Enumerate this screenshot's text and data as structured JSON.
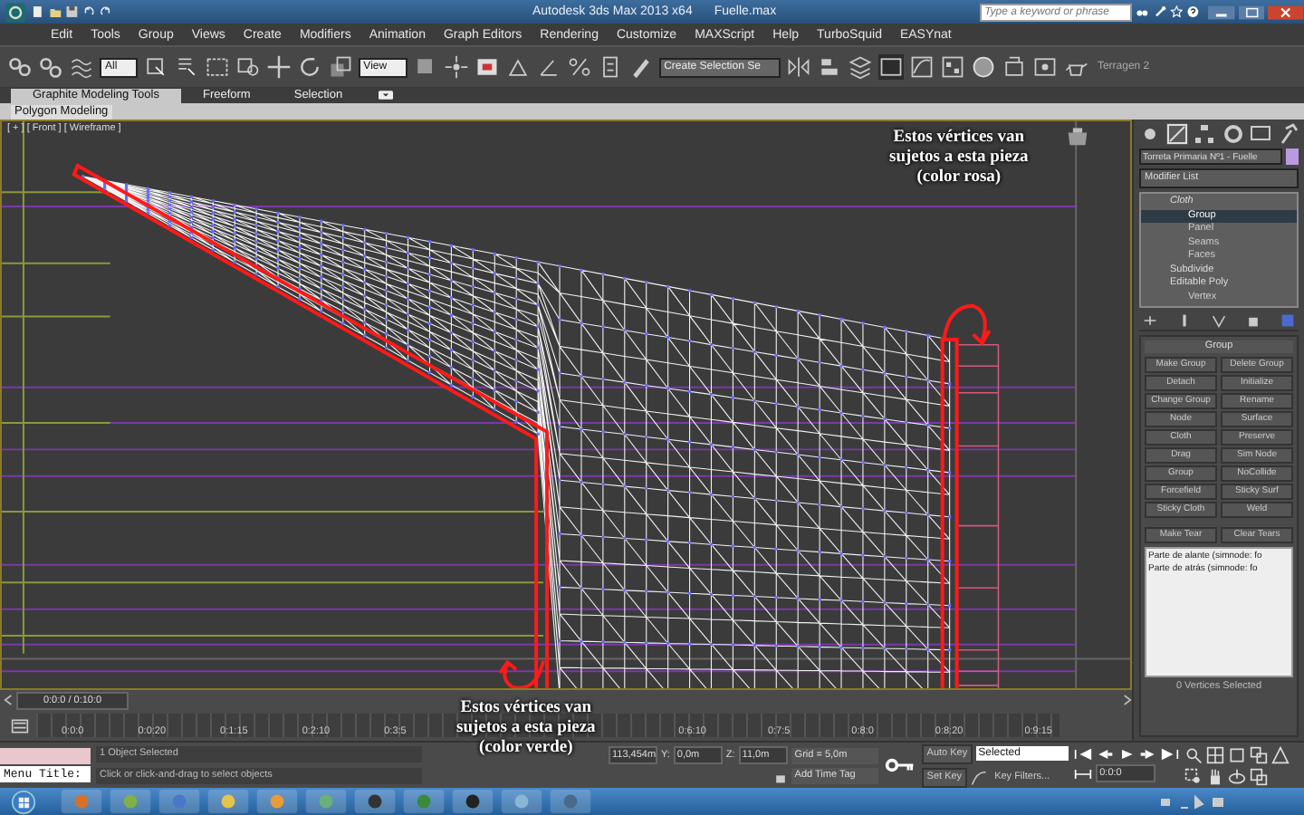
{
  "window": {
    "title": "Autodesk 3ds Max 2013 x64",
    "file": "Fuelle.max",
    "search": {
      "placeholder": "Type a keyword or phrase"
    }
  },
  "menu": [
    "Edit",
    "Tools",
    "Group",
    "Views",
    "Create",
    "Modifiers",
    "Animation",
    "Graph Editors",
    "Rendering",
    "Customize",
    "MAXScript",
    "Help",
    "TurboSquid",
    "EASYnat"
  ],
  "toolbar": {
    "selection_filter": "All",
    "reference_coord": "View",
    "named_selection": "Create Selection Se",
    "plugin_label": "Terragen 2"
  },
  "ribbon": {
    "tabs": [
      {
        "label": "Graphite Modeling Tools",
        "selected": true
      },
      {
        "label": "Freeform",
        "selected": false
      },
      {
        "label": "Selection",
        "selected": false
      }
    ],
    "panel": "Polygon Modeling"
  },
  "viewport": {
    "label": "[ + ] [ Front ] [ Wireframe ]",
    "annotations": [
      {
        "lines": [
          "Estos vértices van",
          "sujetos a esta pieza",
          "(color rosa)"
        ]
      },
      {
        "lines": [
          "Estos vértices van",
          "sujetos a esta pieza",
          "(color verde)"
        ]
      }
    ]
  },
  "command_panel": {
    "object_name": "Torreta Primaria Nº1 - Fuelle",
    "modifier_list": "Modifier List",
    "stack": [
      {
        "label": "Cloth",
        "selected": false,
        "children": [
          {
            "label": "Group",
            "selected": true
          },
          {
            "label": "Panel",
            "selected": false
          },
          {
            "label": "Seams",
            "selected": false
          },
          {
            "label": "Faces",
            "selected": false
          }
        ]
      },
      {
        "label": "Subdivide",
        "selected": false
      },
      {
        "label": "Editable Poly",
        "selected": false,
        "children": [
          {
            "label": "Vertex",
            "selected": false
          }
        ]
      }
    ],
    "rollout": {
      "title": "Group",
      "buttons": [
        "Make Group",
        "Delete Group",
        "Detach",
        "Initialize",
        "Change Group",
        "Rename",
        "Node",
        "Surface",
        "Cloth",
        "Preserve",
        "Drag",
        "Sim Node",
        "Group",
        "NoCollide",
        "Forcefield",
        "Sticky Surf",
        "Sticky Cloth",
        "Weld"
      ],
      "tear_buttons": [
        "Make Tear",
        "Clear Tears"
      ],
      "list": [
        "Parte de alante (simnode: fo",
        "Parte de atrás (simnode: fo"
      ],
      "status": "0 Vertices Selected"
    }
  },
  "timeline": {
    "frame": "0:0:0 / 0:10:0",
    "level": 0,
    "ticks": [
      "0:0:0",
      "0:0:20",
      "0:1:15",
      "0:2:10",
      "0:3:5",
      "0:6:10",
      "0:7:5",
      "0:8:0",
      "0:8:20",
      "0:9:15"
    ]
  },
  "status": {
    "menu_title": "Menu Title:",
    "selection": "1 Object Selected",
    "prompt": "Click or click-and-drag to select objects",
    "x": "113,454m",
    "y_label": "Y:",
    "y": "0,0m",
    "z_label": "Z:",
    "z": "11,0m",
    "grid": "Grid = 5,0m",
    "time_tag": "Add Time Tag",
    "auto_key": "Auto Key",
    "key_mode": "Selected",
    "set_key": "Set Key",
    "key_filters": "Key Filters...",
    "current_frame": "0:0:0"
  }
}
